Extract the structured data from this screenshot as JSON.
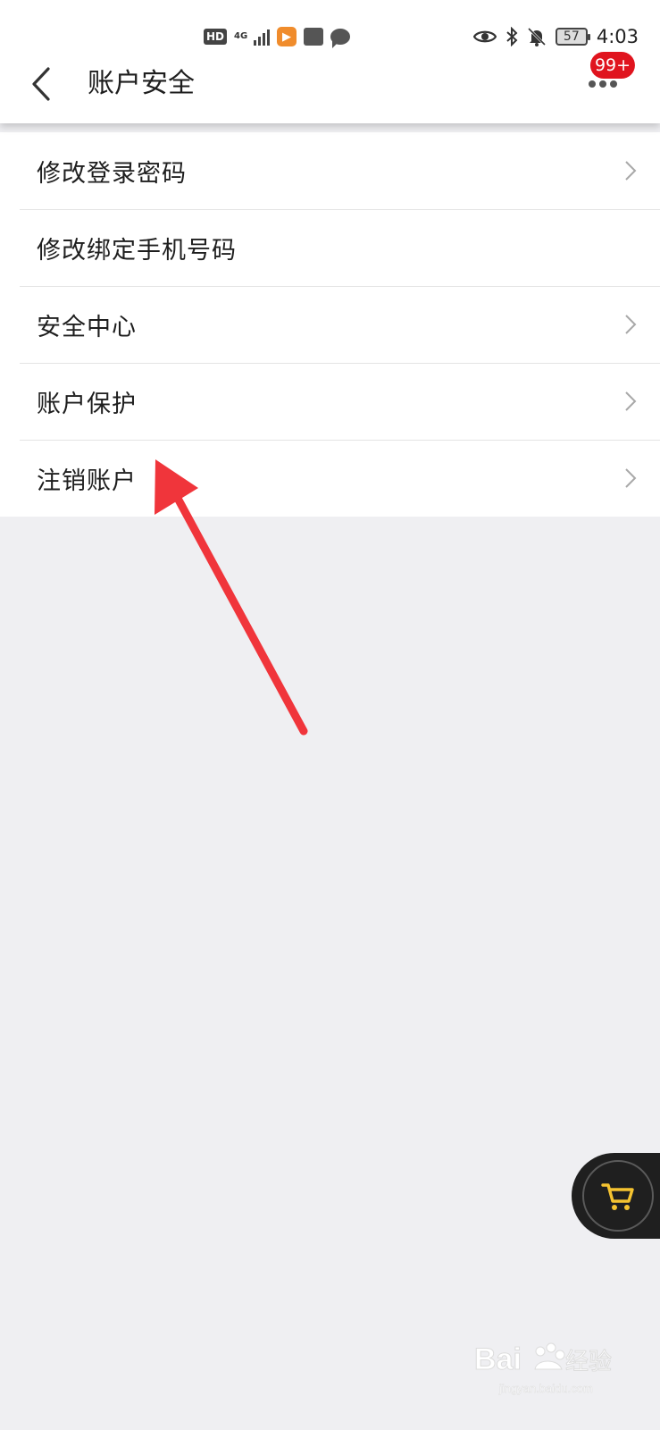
{
  "status_bar": {
    "hd_label": "HD",
    "network_label": "4G",
    "battery_level": "57",
    "time": "4:03",
    "icons": [
      "hd-icon",
      "signal-icon",
      "video-app-icon",
      "huawei-app-icon",
      "chat-icon",
      "eye-icon",
      "bluetooth-icon",
      "bell-muted-icon",
      "battery-icon"
    ]
  },
  "navbar": {
    "back_icon": "chevron-left-icon",
    "title": "账户安全",
    "more_icon": "more-dots-icon",
    "badge": "99+"
  },
  "menu": {
    "items": [
      {
        "label": "修改登录密码",
        "has_chevron": true
      },
      {
        "label": "修改绑定手机号码",
        "has_chevron": false
      },
      {
        "label": "安全中心",
        "has_chevron": true
      },
      {
        "label": "账户保护",
        "has_chevron": true
      },
      {
        "label": "注销账户",
        "has_chevron": true
      }
    ]
  },
  "floating_cart": {
    "icon": "shopping-cart-icon"
  },
  "colors": {
    "accent_badge": "#e0141e",
    "annotation_arrow": "#f0353b",
    "cart_icon": "#f5c330",
    "page_background": "#efeff2"
  }
}
